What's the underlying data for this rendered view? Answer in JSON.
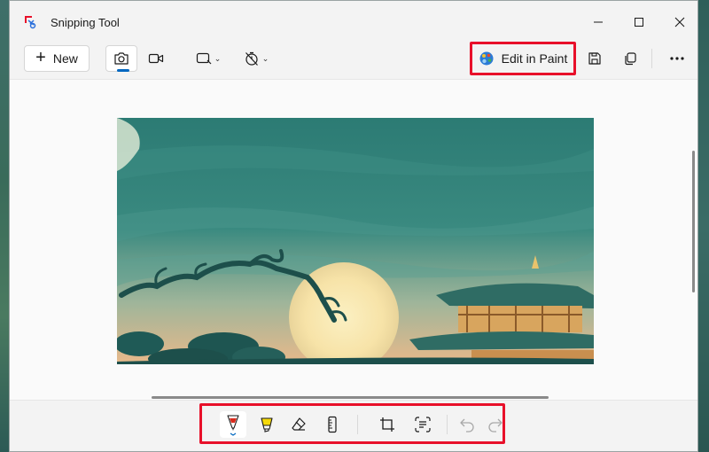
{
  "window": {
    "title": "Snipping Tool",
    "controls": {
      "minimize": "minimize-icon",
      "maximize": "maximize-icon",
      "close": "close-icon"
    }
  },
  "toolbar": {
    "new_label": "New",
    "snip_mode_selected": "screenshot",
    "edit_in_paint_label": "Edit in Paint",
    "highlight_color": "#e8102a"
  },
  "markup_tools": {
    "items": [
      "ballpoint-pen",
      "highlighter",
      "eraser",
      "ruler",
      "crop",
      "text-actions",
      "undo",
      "redo"
    ],
    "active": "ballpoint-pen",
    "pen_color": "#d92a1c",
    "highlighter_color": "#f5d90a"
  },
  "colors": {
    "accent": "#0067c0",
    "annotation": "#e8102a"
  }
}
